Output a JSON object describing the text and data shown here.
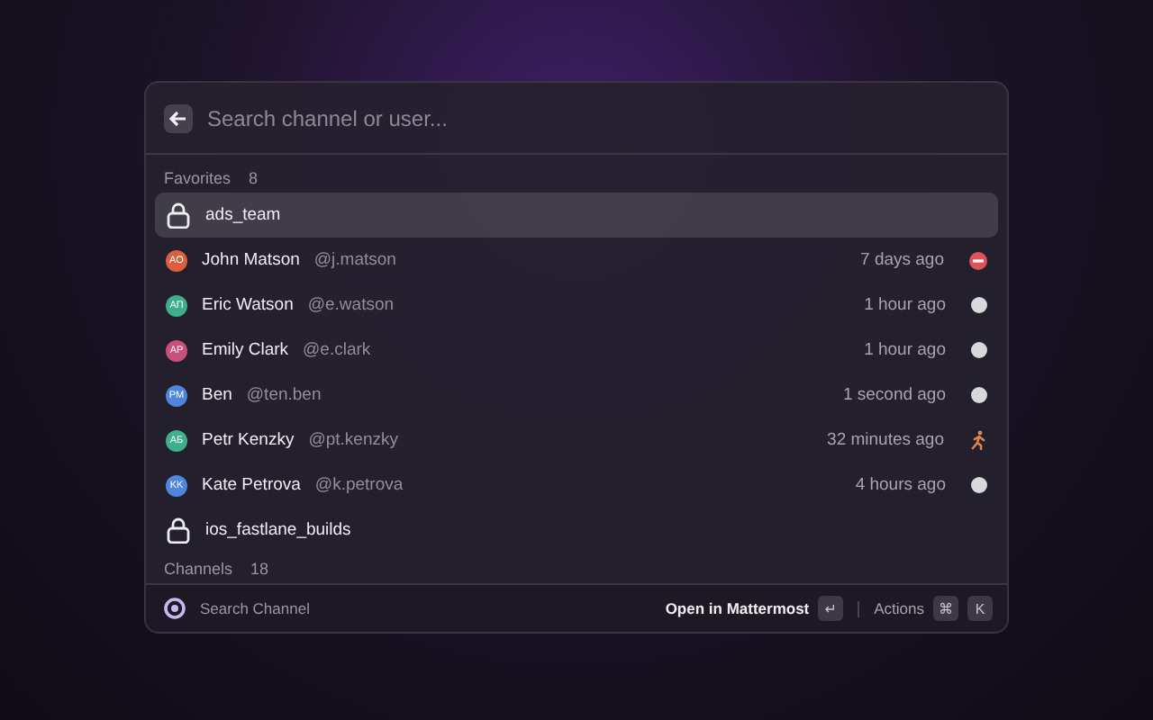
{
  "search": {
    "placeholder": "Search channel or user..."
  },
  "sections": [
    {
      "title": "Favorites",
      "count": "8",
      "items": [
        {
          "kind": "channel",
          "name": "ads_team",
          "selected": true
        },
        {
          "kind": "user",
          "initials": "AO",
          "color": "#d9603f",
          "name": "John Matson",
          "handle": "@j.matson",
          "time": "7 days ago",
          "status": {
            "kind": "dnd"
          },
          "selected": false
        },
        {
          "kind": "user",
          "initials": "AП",
          "color": "#3fae8a",
          "name": "Eric Watson",
          "handle": "@e.watson",
          "time": "1 hour ago",
          "status": {
            "kind": "offline"
          },
          "selected": false
        },
        {
          "kind": "user",
          "initials": "AP",
          "color": "#c8507a",
          "name": "Emily Clark",
          "handle": "@e.clark",
          "time": "1 hour ago",
          "status": {
            "kind": "offline"
          },
          "selected": false
        },
        {
          "kind": "user",
          "initials": "PM",
          "color": "#4f86d9",
          "name": "Ben",
          "handle": "@ten.ben",
          "time": "1 second ago",
          "status": {
            "kind": "offline"
          },
          "selected": false
        },
        {
          "kind": "user",
          "initials": "AБ",
          "color": "#3fae8a",
          "name": "Petr Kenzky",
          "handle": "@pt.kenzky",
          "time": "32 minutes ago",
          "status": {
            "kind": "running"
          },
          "selected": false
        },
        {
          "kind": "user",
          "initials": "KK",
          "color": "#4f86d9",
          "name": "Kate Petrova",
          "handle": "@k.petrova",
          "time": "4 hours ago",
          "status": {
            "kind": "offline"
          },
          "selected": false
        },
        {
          "kind": "channel",
          "name": "ios_fastlane_builds",
          "selected": false
        }
      ]
    },
    {
      "title": "Channels",
      "count": "18"
    }
  ],
  "footer": {
    "title": "Search Channel",
    "primary_action": "Open in Mattermost",
    "primary_key": "↵",
    "actions_label": "Actions",
    "action_keys": [
      "⌘",
      "K"
    ]
  }
}
